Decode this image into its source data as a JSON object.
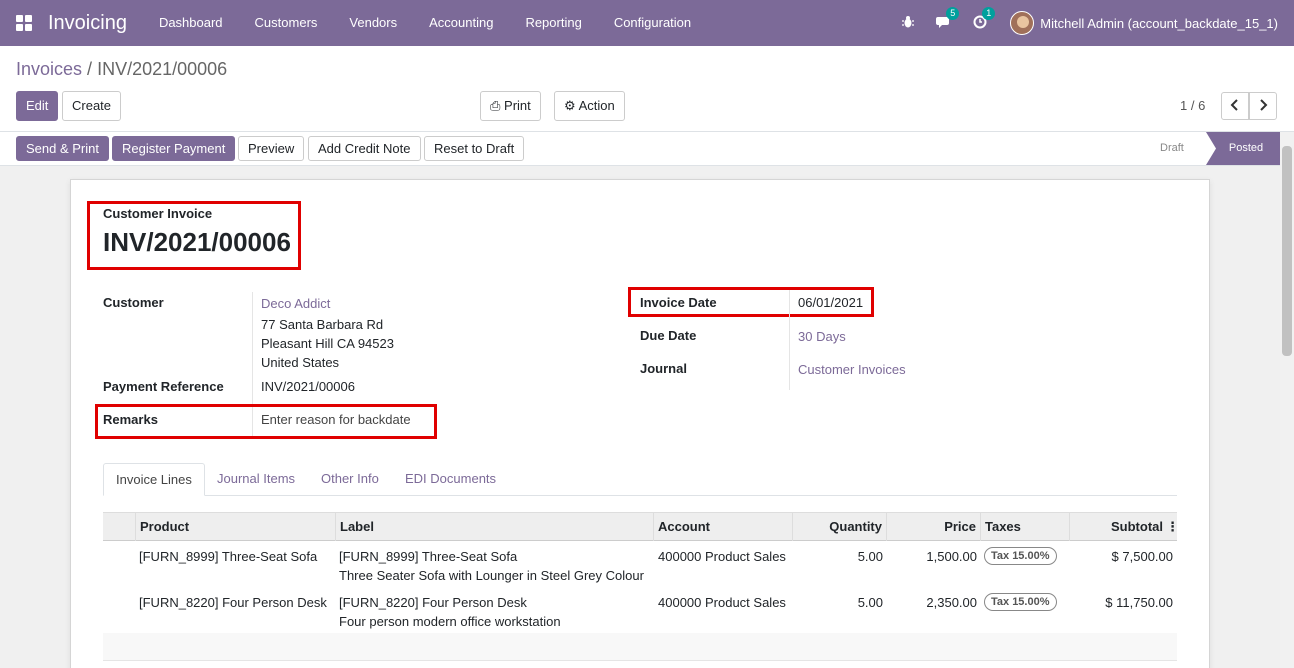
{
  "navbar": {
    "brand": "Invoicing",
    "menu": [
      "Dashboard",
      "Customers",
      "Vendors",
      "Accounting",
      "Reporting",
      "Configuration"
    ],
    "messages_count": "5",
    "activities_count": "1",
    "user": "Mitchell Admin (account_backdate_15_1)"
  },
  "breadcrumb": {
    "parent": "Invoices",
    "sep": " / ",
    "current": "INV/2021/00006"
  },
  "controls": {
    "edit": "Edit",
    "create": "Create",
    "print": "Print",
    "action": "Action",
    "pager": "1 / 6"
  },
  "statusbar": {
    "buttons": [
      "Send & Print",
      "Register Payment",
      "Preview",
      "Add Credit Note",
      "Reset to Draft"
    ],
    "stages": [
      "Draft",
      "Posted"
    ]
  },
  "invoice": {
    "type": "Customer Invoice",
    "name": "INV/2021/00006",
    "customer_label": "Customer",
    "customer_name": "Deco Addict",
    "address1": "77 Santa Barbara Rd",
    "address2": "Pleasant Hill CA 94523",
    "address3": "United States",
    "payment_ref_label": "Payment Reference",
    "payment_ref": "INV/2021/00006",
    "remarks_label": "Remarks",
    "remarks_placeholder": "Enter reason for backdate",
    "invoice_date_label": "Invoice Date",
    "invoice_date": "06/01/2021",
    "due_date_label": "Due Date",
    "due_date": "30 Days",
    "journal_label": "Journal",
    "journal": "Customer Invoices"
  },
  "tabs": [
    "Invoice Lines",
    "Journal Items",
    "Other Info",
    "EDI Documents"
  ],
  "lines": {
    "headers": [
      "Product",
      "Label",
      "Account",
      "Quantity",
      "Price",
      "Taxes",
      "Subtotal"
    ],
    "rows": [
      {
        "product": "[FURN_8999] Three-Seat Sofa",
        "label1": "[FURN_8999] Three-Seat Sofa",
        "label2": "Three Seater Sofa with Lounger in Steel Grey Colour",
        "account": "400000 Product Sales",
        "quantity": "5.00",
        "price": "1,500.00",
        "tax": "Tax 15.00%",
        "subtotal": "$ 7,500.00"
      },
      {
        "product": "[FURN_8220] Four Person Desk",
        "label1": "[FURN_8220] Four Person Desk",
        "label2": "Four person modern office workstation",
        "account": "400000 Product Sales",
        "quantity": "5.00",
        "price": "2,350.00",
        "tax": "Tax 15.00%",
        "subtotal": "$ 11,750.00"
      }
    ]
  },
  "colors": {
    "brand": "#7c6a98",
    "highlight": "#e00000",
    "teal_badge": "#00a09d"
  }
}
